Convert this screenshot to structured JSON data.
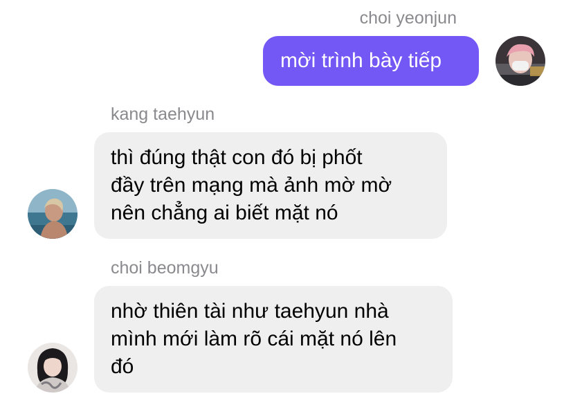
{
  "messages": [
    {
      "sender": "choi yeonjun",
      "direction": "outgoing",
      "lines": [
        "mời trình bày tiếp"
      ]
    },
    {
      "sender": "kang taehyun",
      "direction": "incoming",
      "lines": [
        "thì đúng thật con đó bị phốt",
        "đầy trên mạng mà ảnh mờ mờ",
        "nên chẳng ai biết mặt nó"
      ]
    },
    {
      "sender": "choi beomgyu",
      "direction": "incoming",
      "lines": [
        "nhờ thiên tài như taehyun nhà",
        "mình mới làm rõ cái mặt nó lên",
        "đó"
      ]
    }
  ],
  "colors": {
    "outgoing_bubble": "#7358f5",
    "incoming_bubble": "#efefef",
    "sender_name": "#8a8a8e"
  }
}
